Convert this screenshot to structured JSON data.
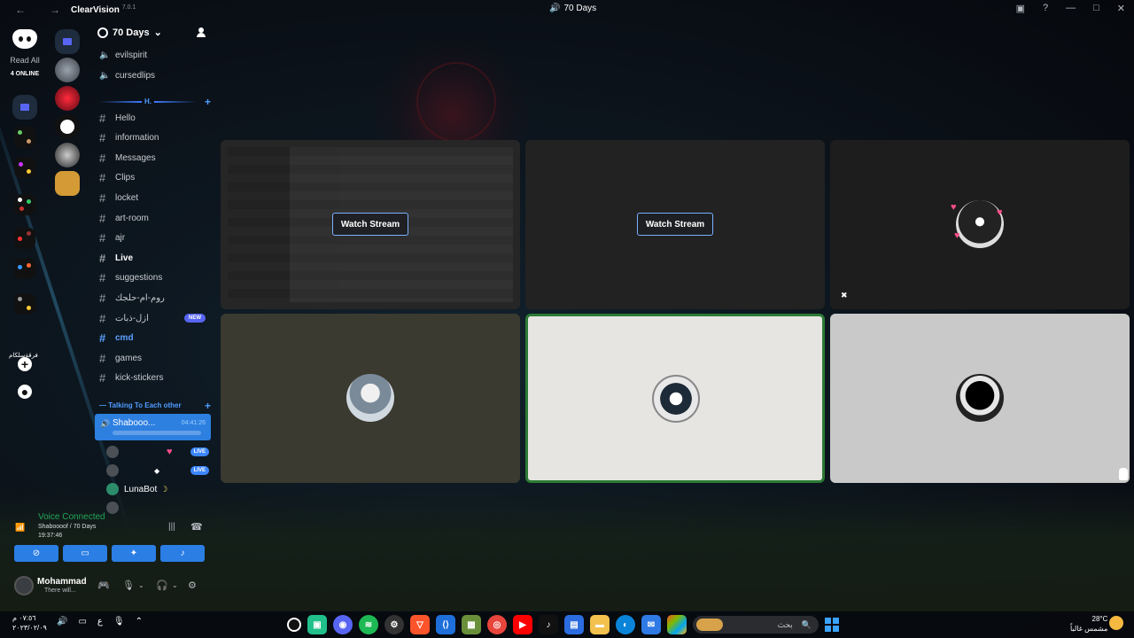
{
  "titlebar": {
    "back": "←",
    "forward": "→",
    "app_name": "ClearVision",
    "version": "7.0.1",
    "window_title": "70 Days",
    "controls": [
      "▣",
      "?",
      "—",
      "□",
      "✕"
    ]
  },
  "servers": {
    "read_all": "Read All",
    "online": "4 ONLINE",
    "text_server": "فرقةسلكام"
  },
  "guild": {
    "name": "70 Days",
    "voice_top": [
      "evilspirit",
      "cursedlips"
    ],
    "category": "H.",
    "text_channels": [
      {
        "name": "Hello",
        "style": "normal"
      },
      {
        "name": "information",
        "style": "normal"
      },
      {
        "name": "Messages",
        "style": "normal"
      },
      {
        "name": "Clips",
        "style": "normal"
      },
      {
        "name": "locket",
        "style": "normal"
      },
      {
        "name": "art-room",
        "style": "normal"
      },
      {
        "name": "ajr",
        "style": "normal"
      },
      {
        "name": "Live",
        "style": "bold"
      },
      {
        "name": "suggestions",
        "style": "normal"
      },
      {
        "name": "روم-ام-حلجك",
        "style": "normal"
      },
      {
        "name": "ازل-ذبات",
        "style": "normal",
        "badge": "NEW"
      },
      {
        "name": "cmd",
        "style": "active"
      },
      {
        "name": "games",
        "style": "normal"
      },
      {
        "name": "kick-stickers",
        "style": "normal"
      }
    ],
    "voice_category": "Talking To Each other",
    "voice_active": {
      "name": "Shabooo...",
      "time": "04:41:26"
    },
    "live_badge": "LIVE",
    "bot_user": "LunaBot"
  },
  "voice_panel": {
    "title": "Voice Connected",
    "sub": "Shaboooof / 70 Days",
    "time": "19:37:46"
  },
  "user_panel": {
    "name": "Mohammad",
    "status": "There will..."
  },
  "stage": {
    "watch_stream": "Watch Stream"
  },
  "taskbar": {
    "time": "٠٧:٥٦ م",
    "date": "٢٠٢٣/٠٢/٠٩",
    "search": "بحث",
    "temp": "28°C",
    "weather": "مشمس غالباً",
    "tray_lang": "ع"
  },
  "colors": {
    "accent": "#2d7fe0",
    "connected_green": "#23a55a",
    "active_channel": "#5aa0ff"
  }
}
